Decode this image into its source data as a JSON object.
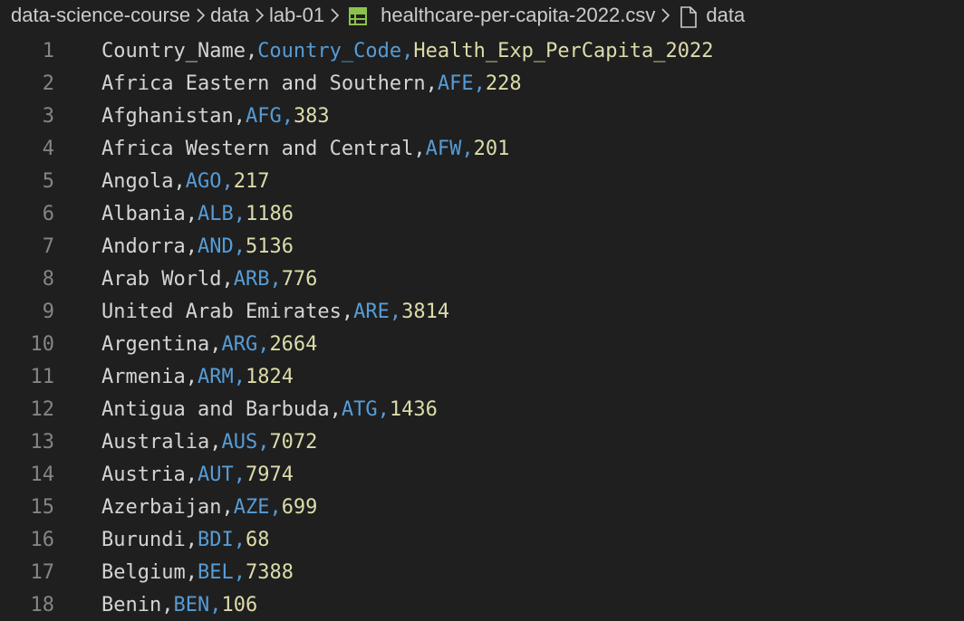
{
  "breadcrumb": {
    "items": [
      "data-science-course",
      "data",
      "lab-01",
      "healthcare-per-capita-2022.csv",
      "data"
    ]
  },
  "colors": {
    "background": "#1f1f1f",
    "line_number": "#858585",
    "column1": "#d4d4d4",
    "column2": "#569cd6",
    "column3": "#dcdcaa",
    "csv_icon": "#8bc34a"
  },
  "icons": {
    "separator": "chevron-right-icon",
    "file_type": "table-icon",
    "symbol": "file-icon"
  },
  "editor": {
    "lines": [
      {
        "num": "1",
        "c1": "Country_Name,",
        "c2": "Country_Code,",
        "c3": "Health_Exp_PerCapita_2022"
      },
      {
        "num": "2",
        "c1": "Africa Eastern and Southern,",
        "c2": "AFE,",
        "c3": "228"
      },
      {
        "num": "3",
        "c1": "Afghanistan,",
        "c2": "AFG,",
        "c3": "383"
      },
      {
        "num": "4",
        "c1": "Africa Western and Central,",
        "c2": "AFW,",
        "c3": "201"
      },
      {
        "num": "5",
        "c1": "Angola,",
        "c2": "AGO,",
        "c3": "217"
      },
      {
        "num": "6",
        "c1": "Albania,",
        "c2": "ALB,",
        "c3": "1186"
      },
      {
        "num": "7",
        "c1": "Andorra,",
        "c2": "AND,",
        "c3": "5136"
      },
      {
        "num": "8",
        "c1": "Arab World,",
        "c2": "ARB,",
        "c3": "776"
      },
      {
        "num": "9",
        "c1": "United Arab Emirates,",
        "c2": "ARE,",
        "c3": "3814"
      },
      {
        "num": "10",
        "c1": "Argentina,",
        "c2": "ARG,",
        "c3": "2664"
      },
      {
        "num": "11",
        "c1": "Armenia,",
        "c2": "ARM,",
        "c3": "1824"
      },
      {
        "num": "12",
        "c1": "Antigua and Barbuda,",
        "c2": "ATG,",
        "c3": "1436"
      },
      {
        "num": "13",
        "c1": "Australia,",
        "c2": "AUS,",
        "c3": "7072"
      },
      {
        "num": "14",
        "c1": "Austria,",
        "c2": "AUT,",
        "c3": "7974"
      },
      {
        "num": "15",
        "c1": "Azerbaijan,",
        "c2": "AZE,",
        "c3": "699"
      },
      {
        "num": "16",
        "c1": "Burundi,",
        "c2": "BDI,",
        "c3": "68"
      },
      {
        "num": "17",
        "c1": "Belgium,",
        "c2": "BEL,",
        "c3": "7388"
      },
      {
        "num": "18",
        "c1": "Benin,",
        "c2": "BEN,",
        "c3": "106"
      }
    ]
  }
}
